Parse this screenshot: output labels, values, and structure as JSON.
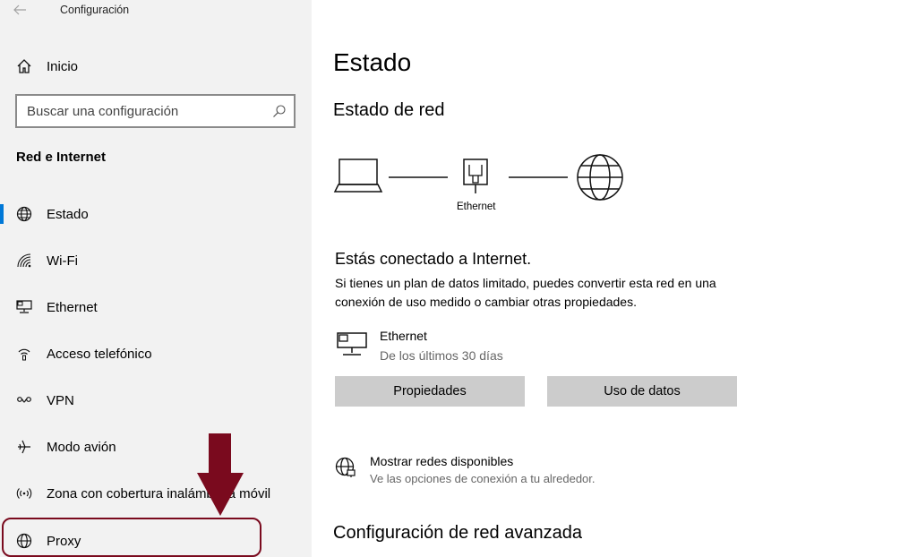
{
  "window": {
    "title": "Configuración",
    "back_icon": "back-arrow-icon"
  },
  "sidebar": {
    "home_label": "Inicio",
    "search_placeholder": "Buscar una configuración",
    "section_title": "Red e Internet",
    "items": [
      {
        "label": "Estado",
        "icon": "globe-icon",
        "selected": true
      },
      {
        "label": "Wi-Fi",
        "icon": "wifi-icon",
        "selected": false
      },
      {
        "label": "Ethernet",
        "icon": "ethernet-icon",
        "selected": false
      },
      {
        "label": "Acceso telefónico",
        "icon": "dialup-icon",
        "selected": false
      },
      {
        "label": "VPN",
        "icon": "vpn-icon",
        "selected": false
      },
      {
        "label": "Modo avión",
        "icon": "airplane-icon",
        "selected": false
      },
      {
        "label": "Zona con cobertura inalámbrica móvil",
        "icon": "hotspot-icon",
        "selected": false
      },
      {
        "label": "Proxy",
        "icon": "globe-icon",
        "selected": false
      }
    ]
  },
  "main": {
    "title": "Estado",
    "network_status_title": "Estado de red",
    "diagram_caption": "Ethernet",
    "connected_text": "Estás conectado a Internet.",
    "description": "Si tienes un plan de datos limitado, puedes convertir esta red en una conexión de uso medido o cambiar otras propiedades.",
    "connection": {
      "name": "Ethernet",
      "subtitle": "De los últimos 30 días"
    },
    "buttons": {
      "properties": "Propiedades",
      "data_usage": "Uso de datos"
    },
    "available": {
      "title": "Mostrar redes disponibles",
      "subtitle": "Ve las opciones de conexión a tu alrededor."
    },
    "advanced_title": "Configuración de red avanzada"
  },
  "annotation_color": "#7a0a1e",
  "accent_color": "#0078d7"
}
